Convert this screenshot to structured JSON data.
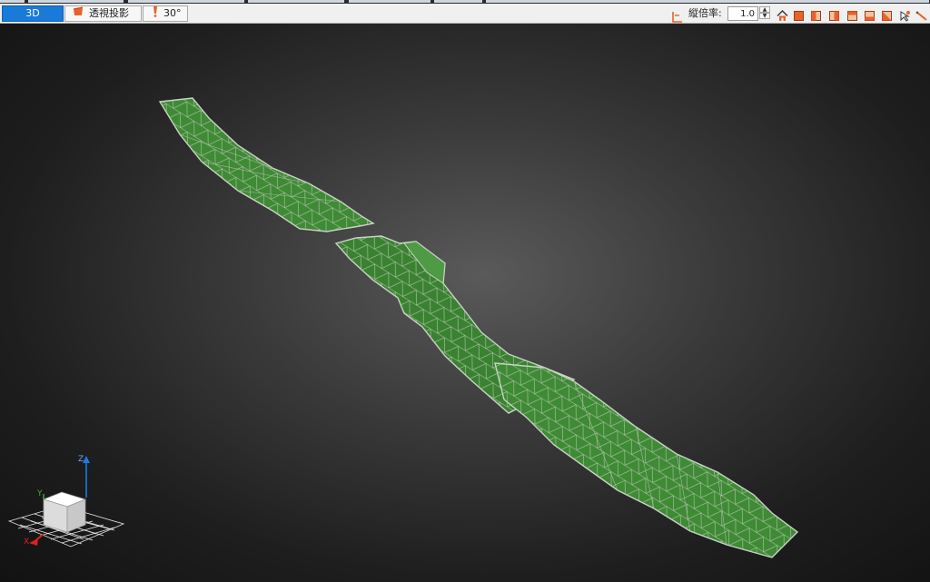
{
  "toolbar": {
    "mode_label": "3D",
    "projection_label": "透視投影",
    "angle_label": "30°",
    "ratio_label": "縦倍率:",
    "ratio_value": "1.0",
    "tool_icons": [
      "home-icon",
      "box-icon",
      "front-view-icon",
      "back-view-icon",
      "left-view-icon",
      "right-view-icon",
      "top-view-icon",
      "bottom-view-icon",
      "select-icon",
      "measure-icon"
    ]
  },
  "colors": {
    "mesh_fill": "#3f8a35",
    "mesh_edge": "#c9d4c6",
    "active_tab": "#1a7ad8",
    "accent_orange": "#e8622a"
  },
  "axes": {
    "x": "X",
    "y": "Y",
    "z": "Z"
  }
}
